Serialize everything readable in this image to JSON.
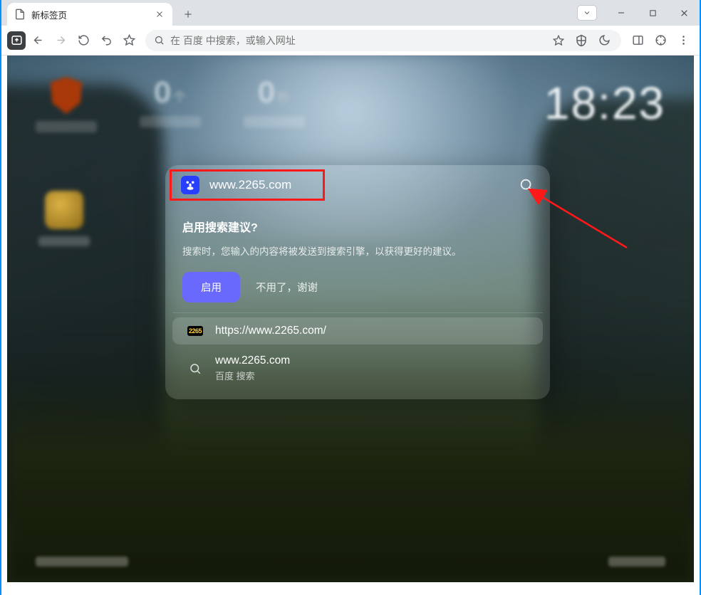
{
  "tab": {
    "title": "新标签页"
  },
  "addressbar": {
    "placeholder": "在 百度 中搜索，或输入网址"
  },
  "stats": {
    "s2": {
      "value": "0",
      "unit": "个"
    },
    "s3": {
      "value": "0",
      "unit": "秒"
    }
  },
  "clock": "18:23",
  "panel": {
    "query": "www.2265.com",
    "prompt_title": "启用搜索建议?",
    "prompt_body": "搜索时，您输入的内容将被发送到搜索引擎，以获得更好的建议。",
    "enable": "启用",
    "dismiss": "不用了，谢谢",
    "sugg1": {
      "url": "https://www.2265.com/",
      "fav": "2265"
    },
    "sugg2": {
      "url": "www.2265.com",
      "sub": "百度 搜索"
    }
  }
}
